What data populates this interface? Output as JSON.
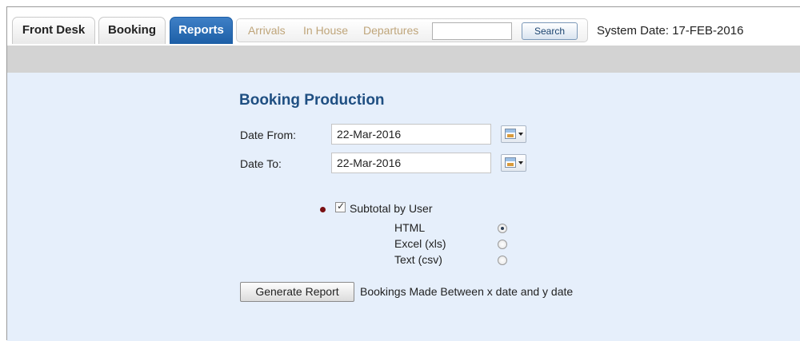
{
  "tabs": [
    {
      "label": "Front Desk",
      "active": false
    },
    {
      "label": "Booking",
      "active": false
    },
    {
      "label": "Reports",
      "active": true
    }
  ],
  "subnav": {
    "links": [
      "Arrivals",
      "In House",
      "Departures"
    ],
    "search_value": "",
    "search_button": "Search"
  },
  "system_date": "System Date: 17-FEB-2016",
  "report": {
    "title": "Booking Production",
    "date_from_label": "Date From:",
    "date_from_value": "22-Mar-2016",
    "date_to_label": "Date To:",
    "date_to_value": "22-Mar-2016",
    "subtotal_label": "Subtotal by User",
    "subtotal_checked": true,
    "formats": [
      {
        "label": "HTML",
        "selected": true
      },
      {
        "label": "Excel (xls)",
        "selected": false
      },
      {
        "label": "Text (csv)",
        "selected": false
      }
    ],
    "generate_button": "Generate Report",
    "description": "Bookings Made Between x date and y date"
  },
  "colors": {
    "active_tab": "#1c5ea6",
    "content_bg": "#e6effb",
    "title": "#1f4f82",
    "subnav_link": "#bfa57a",
    "required_bullet": "#7a0f12"
  }
}
